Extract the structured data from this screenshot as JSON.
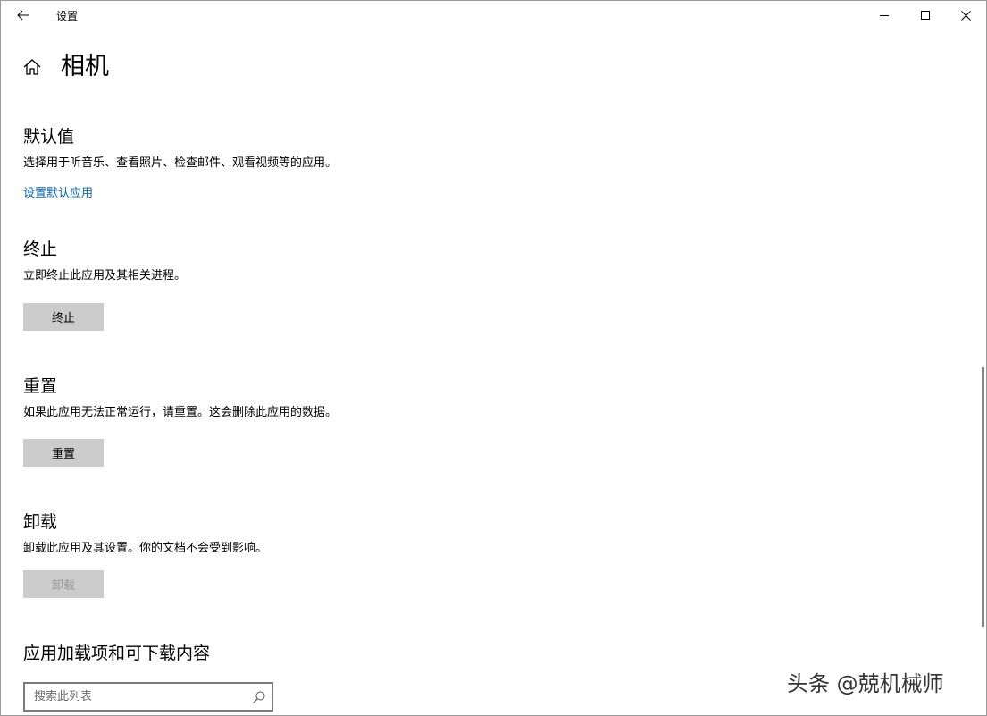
{
  "window": {
    "app_title": "设置"
  },
  "header": {
    "page_title": "相机"
  },
  "sections": {
    "defaults": {
      "title": "默认值",
      "description": "选择用于听音乐、查看照片、检查邮件、观看视频等的应用。",
      "link": "设置默认应用"
    },
    "terminate": {
      "title": "终止",
      "description": "立即终止此应用及其相关进程。",
      "button": "终止"
    },
    "reset": {
      "title": "重置",
      "description": "如果此应用无法正常运行，请重置。这会删除此应用的数据。",
      "button": "重置"
    },
    "uninstall": {
      "title": "卸载",
      "description": "卸载此应用及其设置。你的文档不会受到影响。",
      "button": "卸载",
      "button_disabled": true
    },
    "addons": {
      "title": "应用加载项和可下载内容",
      "search_placeholder": "搜索此列表"
    }
  },
  "watermark": "头条 @兢机械师",
  "icons": {
    "back": "back-arrow-icon",
    "minimize": "minimize-icon",
    "maximize": "maximize-icon",
    "close": "close-icon",
    "home": "home-icon",
    "search": "search-icon"
  },
  "colors": {
    "link": "#0067c0",
    "button": "#cccccc",
    "button_disabled_text": "#9a9a9a"
  }
}
